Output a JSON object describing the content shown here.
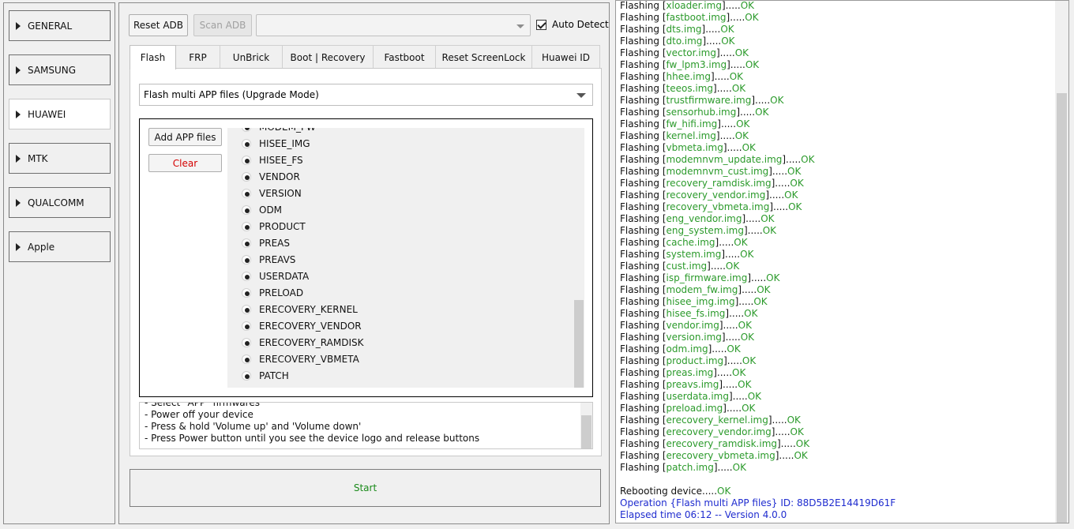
{
  "sidebar": {
    "items": [
      {
        "label": "GENERAL",
        "active": false
      },
      {
        "label": "SAMSUNG",
        "active": false
      },
      {
        "label": "HUAWEI",
        "active": true
      },
      {
        "label": "MTK",
        "active": false
      },
      {
        "label": "QUALCOMM",
        "active": false
      },
      {
        "label": "Apple",
        "active": false
      }
    ]
  },
  "toolbar": {
    "reset_adb": "Reset ADB",
    "scan_adb": "Scan ADB",
    "device_value": "",
    "auto_detect_label": "Auto Detect",
    "auto_detect_checked": true
  },
  "tabs": [
    "Flash",
    "FRP",
    "UnBrick",
    "Boot | Recovery",
    "Fastboot",
    "Reset ScreenLock",
    "Huawei ID"
  ],
  "active_tab": "Flash",
  "flash": {
    "mode": "Flash multi APP files (Upgrade Mode)",
    "add_app_files": "Add APP files",
    "clear": "Clear",
    "partitions": [
      "MODEM_FW",
      "HISEE_IMG",
      "HISEE_FS",
      "VENDOR",
      "VERSION",
      "ODM",
      "PRODUCT",
      "PREAS",
      "PREAVS",
      "USERDATA",
      "PRELOAD",
      "ERECOVERY_KERNEL",
      "ERECOVERY_VENDOR",
      "ERECOVERY_RAMDISK",
      "ERECOVERY_VBMETA",
      "PATCH"
    ],
    "instructions": [
      "- Select \"APP\" firmwares",
      "- Power off your device",
      "- Press & hold 'Volume up' and 'Volume down'",
      "- Press Power button until you see the device logo and release buttons"
    ]
  },
  "start_label": "Start",
  "log": {
    "prefix": "Flashing",
    "ok": "OK",
    "files": [
      "xloader.img",
      "fastboot.img",
      "dts.img",
      "dto.img",
      "vector.img",
      "fw_lpm3.img",
      "hhee.img",
      "teeos.img",
      "trustfirmware.img",
      "sensorhub.img",
      "fw_hifi.img",
      "kernel.img",
      "vbmeta.img",
      "modemnvm_update.img",
      "modemnvm_cust.img",
      "recovery_ramdisk.img",
      "recovery_vendor.img",
      "recovery_vbmeta.img",
      "eng_vendor.img",
      "eng_system.img",
      "cache.img",
      "system.img",
      "cust.img",
      "isp_firmware.img",
      "modem_fw.img",
      "hisee_img.img",
      "hisee_fs.img",
      "vendor.img",
      "version.img",
      "odm.img",
      "product.img",
      "preas.img",
      "preavs.img",
      "userdata.img",
      "preload.img",
      "erecovery_kernel.img",
      "erecovery_vendor.img",
      "erecovery_ramdisk.img",
      "erecovery_vbmeta.img",
      "patch.img"
    ],
    "reboot_text": "Rebooting device.....",
    "operation_text": "Operation {Flash multi APP files} ID: 88D5B2E14419D61F",
    "elapsed_text": "Elapsed time 06:12 -- Version 4.0.0"
  }
}
